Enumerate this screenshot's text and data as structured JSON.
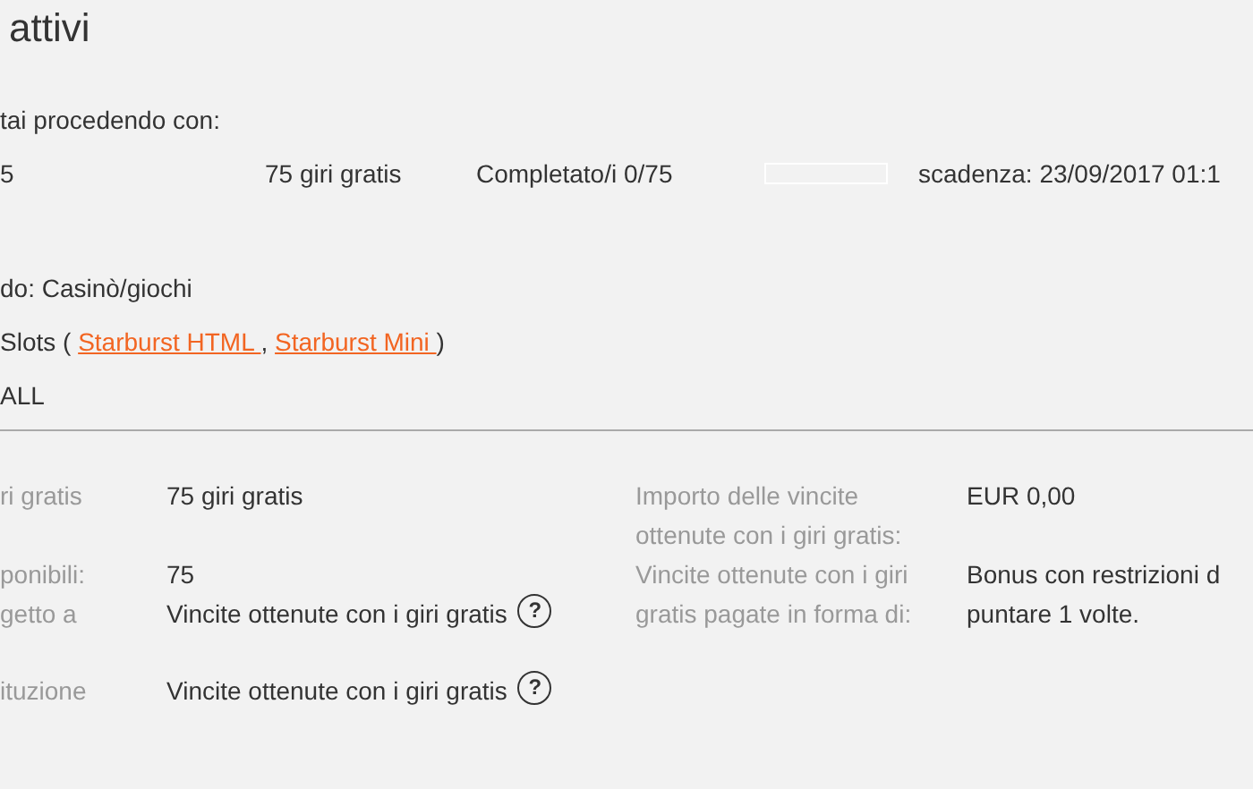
{
  "title": "attivi",
  "intro": "tai procedendo con:",
  "summary": {
    "cells": [
      "5",
      "75 giri gratis",
      "Completato/i 0/75"
    ],
    "progress": {
      "level": 0
    },
    "expiry": "scadenza: 23/09/2017 01:1"
  },
  "mode": "do: Casinò/giochi",
  "games": {
    "prefix": "Slots (",
    "links": [
      "Starburst HTML",
      "Starburst Mini"
    ],
    "separator": ",",
    "suffix": ")"
  },
  "platform": "ALL",
  "details_left": [
    {
      "label": "ri gratis",
      "value": "75 giri gratis"
    },
    {
      "label": "ponibili:",
      "value": "75"
    },
    {
      "label": "getto a",
      "value": "Vincite ottenute con i giri gratis",
      "help": "?"
    },
    {
      "label": "ituzione",
      "value": "Vincite ottenute con i giri gratis",
      "help": "?"
    }
  ],
  "details_right": [
    {
      "label": [
        "Importo delle vincite",
        "ottenute con i giri gratis:"
      ],
      "value": [
        "EUR 0,00"
      ]
    },
    {
      "label": [
        "Vincite ottenute con i giri",
        "gratis pagate in forma di:"
      ],
      "value": [
        "Bonus con restrizioni d",
        "puntare 1 volte."
      ]
    }
  ]
}
